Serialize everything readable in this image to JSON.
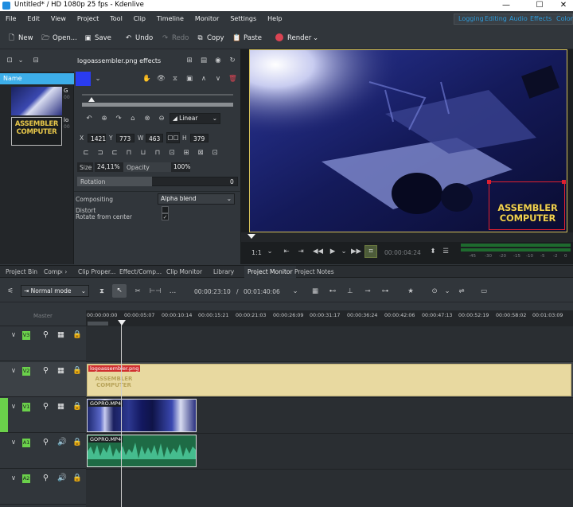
{
  "window": {
    "title": "Untitled* / HD 1080p 25 fps - Kdenlive"
  },
  "menubar": {
    "items": [
      "File",
      "Edit",
      "View",
      "Project",
      "Tool",
      "Clip",
      "Timeline",
      "Monitor",
      "Settings",
      "Help"
    ],
    "workspaces": [
      "Logging",
      "Editing",
      "Audio",
      "Effects",
      "Color"
    ]
  },
  "toolbar": {
    "new": "New",
    "open": "Open...",
    "save": "Save",
    "undo": "Undo",
    "redo": "Redo",
    "copy": "Copy",
    "paste": "Paste",
    "render": "Render"
  },
  "bin": {
    "column": "Name",
    "items": [
      {
        "name_fragment": "G",
        "sub": "00"
      },
      {
        "name_fragment": "lo",
        "sub": "00"
      }
    ]
  },
  "effects": {
    "title": "logoassembler.png effects",
    "keyframe_interp": "Linear",
    "x_label": "X",
    "x": "1421",
    "y_label": "Y",
    "y": "773",
    "w_label": "W",
    "w": "463",
    "h_label": "H",
    "h": "379",
    "size_label": "Size",
    "size": "24,11%",
    "opacity_label": "Opacity",
    "opacity": "100%",
    "rotation_label": "Rotation",
    "rotation": "0",
    "compositing_label": "Compositing",
    "compositing": "Alpha blend",
    "distort_label": "Distort",
    "rotate_center_label": "Rotate from center"
  },
  "monitor": {
    "zoom": "1:1",
    "timecode": "00:00:04:24",
    "overlay_line1": "ASSEMBLER",
    "overlay_line2": "COMPUTER",
    "db_scale": [
      "-45",
      "-30",
      "-20",
      "-15",
      "-10",
      "-5",
      "-2",
      "0"
    ]
  },
  "tabs": [
    "Project Bin",
    "Comp",
    "Clip Proper...",
    "Effect/Comp...",
    "Clip Monitor",
    "Library",
    "Project Monitor",
    "Project Notes"
  ],
  "timeline": {
    "mode": "Normal mode",
    "position": "00:00:23:10",
    "duration": "00:01:40:06",
    "header": "Master",
    "ruler": [
      "00:00:00:00",
      "00:00:05:07",
      "00:00:10:14",
      "00:00:15:21",
      "00:00:21:03",
      "00:00:26:09",
      "00:00:31:17",
      "00:00:36:24",
      "00:00:42:06",
      "00:00:47:13",
      "00:00:52:19",
      "00:00:58:02",
      "00:01:03:09"
    ],
    "tracks": [
      {
        "name": "V3"
      },
      {
        "name": "V2"
      },
      {
        "name": "V1"
      },
      {
        "name": "A1"
      },
      {
        "name": "A2"
      }
    ],
    "clips": {
      "logo": "logoassembler.png",
      "video": "GOPRO.MP4",
      "audio": "GOPRO.MP4"
    }
  },
  "colors": {
    "accent": "#3daee9",
    "track_label": "#6bd14b",
    "logo_clip": "#e8d9a0",
    "video_clip": "#2d3a80",
    "audio_clip": "#1e6b45",
    "render": "#da4453"
  }
}
